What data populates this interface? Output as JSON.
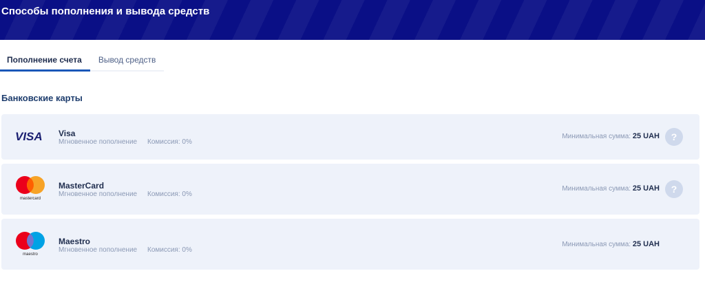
{
  "header": {
    "title": "Способы пополнения и вывода средств"
  },
  "tabs": [
    {
      "label": "Пополнение счета",
      "active": true
    },
    {
      "label": "Вывод средств",
      "active": false
    }
  ],
  "section": {
    "title": "Банковские карты"
  },
  "methods": [
    {
      "name": "Visa",
      "logo_text": "VISA",
      "subtitle": "Мгновенное пополнение",
      "commission": "Комиссия: 0%",
      "min_label": "Минимальная сумма:",
      "min_value": "25 UAH",
      "help": "?"
    },
    {
      "name": "MasterCard",
      "logo_text": "mastercard",
      "subtitle": "Мгновенное пополнение",
      "commission": "Комиссия: 0%",
      "min_label": "Минимальная сумма:",
      "min_value": "25 UAH",
      "help": "?"
    },
    {
      "name": "Maestro",
      "logo_text": "maestro",
      "subtitle": "Мгновенное пополнение",
      "commission": "Комиссия: 0%",
      "min_label": "Минимальная сумма:",
      "min_value": "25 UAH"
    }
  ],
  "colors": {
    "header_bg": "#0a0f86",
    "card_bg": "#eef2fa",
    "accent": "#1a57b8"
  }
}
